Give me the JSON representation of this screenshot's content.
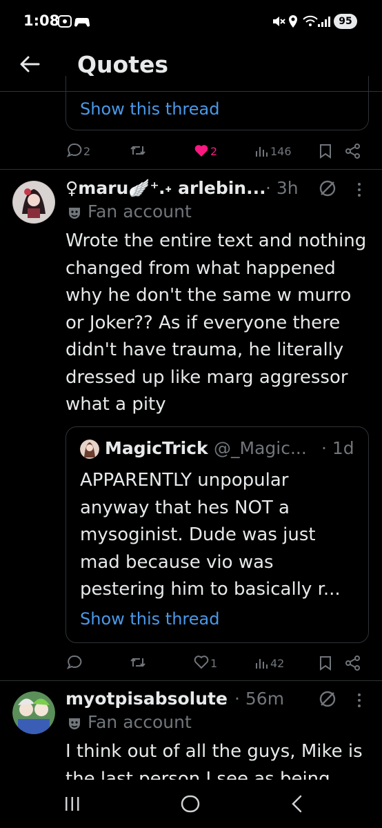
{
  "status": {
    "time": "1:08",
    "battery": "95"
  },
  "header": {
    "title": "Quotes"
  },
  "prev_tweet": {
    "show_thread": "Show this thread",
    "replies": "2",
    "likes": "2",
    "views": "146"
  },
  "tweet1": {
    "display_name": "♀maru🪽⁺․˖ arlebin...",
    "time": "· 3h",
    "label": "Fan account",
    "text": "Wrote the entire text and nothing changed from what happened why he don't the same w murro or Joker?? As if everyone there didn't have trauma, he literally dressed up like marg aggressor what a pity",
    "quote": {
      "name": "MagicTrick",
      "handle": "@_Magic...",
      "time": "· 1d",
      "text": "APPARENTLY unpopular anyway that hes NOT a mysoginist. Dude was just mad because vio was pestering him to basically r...",
      "show_thread": "Show this thread"
    },
    "likes": "1",
    "views": "42"
  },
  "tweet2": {
    "display_name": "myotpisabsolute",
    "time": "· 56m",
    "label": "Fan account",
    "text": "I think out of all the guys, Mike is the last person I see as being"
  },
  "colors": {
    "accent": "#4a99e9",
    "like": "#f91880",
    "muted": "#71767b",
    "background": "#000000"
  }
}
